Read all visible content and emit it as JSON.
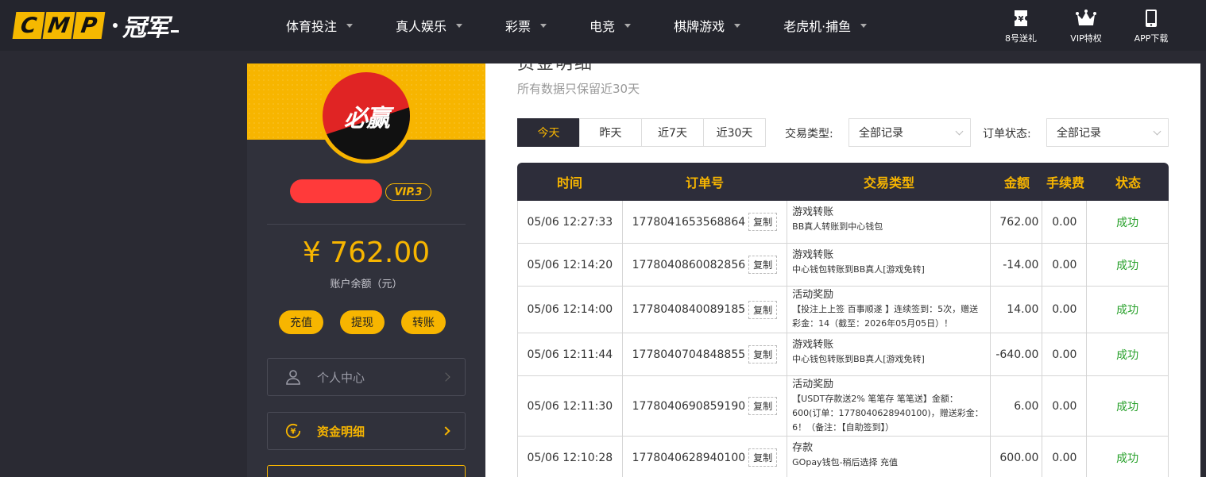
{
  "logo": {
    "tiles": [
      "C",
      "M",
      "P"
    ],
    "cn": "冠军"
  },
  "nav": [
    {
      "label": "体育投注"
    },
    {
      "label": "真人娱乐"
    },
    {
      "label": "彩票"
    },
    {
      "label": "电竞"
    },
    {
      "label": "棋牌游戏"
    },
    {
      "label": "老虎机·捕鱼"
    }
  ],
  "top_right": [
    {
      "label": "8号送礼",
      "icon": "ticket-yen-icon"
    },
    {
      "label": "VIP特权",
      "icon": "crown-icon"
    },
    {
      "label": "APP下载",
      "icon": "phone-icon"
    }
  ],
  "profile": {
    "avatar_text": "必赢",
    "vip": "VIP.3",
    "balance": "¥ 762.00",
    "balance_label": "账户余额（元）",
    "actions": [
      "充值",
      "提现",
      "转账"
    ],
    "menu": [
      {
        "label": "个人中心",
        "icon": "user-icon"
      },
      {
        "label": "资金明细",
        "icon": "yen-coin-icon"
      }
    ]
  },
  "main": {
    "title": "资金明细",
    "subtitle": "所有数据只保留近30天",
    "tabs": [
      "今天",
      "昨天",
      "近7天",
      "近30天"
    ],
    "filters": {
      "type_label": "交易类型:",
      "type_value": "全部记录",
      "status_label": "订单状态:",
      "status_value": "全部记录"
    },
    "columns": [
      "时间",
      "订单号",
      "交易类型",
      "金额",
      "手续费",
      "状态"
    ],
    "copy_label": "复制",
    "rows": [
      {
        "time": "05/06 12:27:33",
        "order": "1778041653568864",
        "type": "游戏转账",
        "desc": "BB真人转账到中心钱包",
        "amount": "762.00",
        "fee": "0.00",
        "status": "成功"
      },
      {
        "time": "05/06 12:14:20",
        "order": "1778040860082856",
        "type": "游戏转账",
        "desc": "中心钱包转账到BB真人[游戏免转]",
        "amount": "-14.00",
        "fee": "0.00",
        "status": "成功"
      },
      {
        "time": "05/06 12:14:00",
        "order": "1778040840089185",
        "type": "活动奖励",
        "desc": "【投注上上签 百事顺遂 】连续签到：5次，赠送彩金：14（截至：2026年05月05日）！",
        "amount": "14.00",
        "fee": "0.00",
        "status": "成功"
      },
      {
        "time": "05/06 12:11:44",
        "order": "1778040704848855",
        "type": "游戏转账",
        "desc": "中心钱包转账到BB真人[游戏免转]",
        "amount": "-640.00",
        "fee": "0.00",
        "status": "成功"
      },
      {
        "time": "05/06 12:11:30",
        "order": "1778040690859190",
        "type": "活动奖励",
        "desc": "【USDT存款送2% 笔笔存 笔笔送】金额：600(订单：1778040628940100)，赠送彩金：6！（备注：【自助签到】）",
        "amount": "6.00",
        "fee": "0.00",
        "status": "成功"
      },
      {
        "time": "05/06 12:10:28",
        "order": "1778040628940100",
        "type": "存款",
        "desc": "GOpay钱包-稍后选择 充值",
        "amount": "600.00",
        "fee": "0.00",
        "status": "成功"
      }
    ]
  }
}
